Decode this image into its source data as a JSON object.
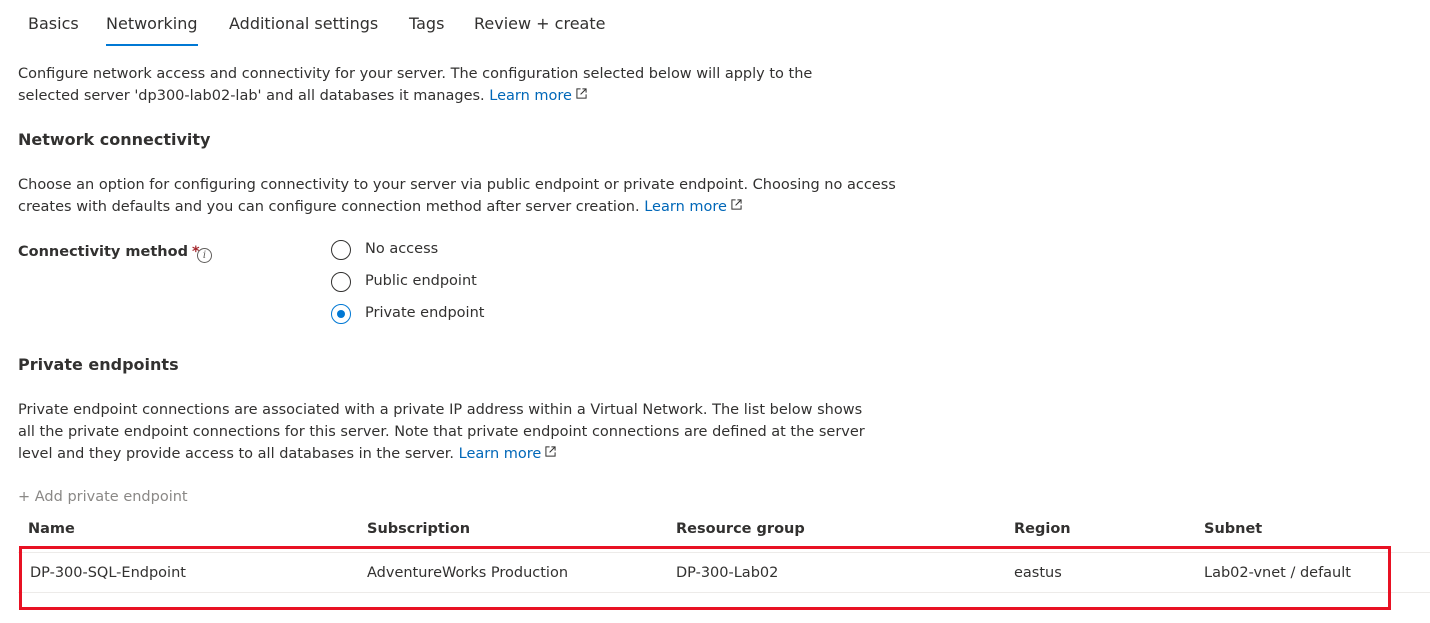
{
  "tabs": [
    {
      "label": "Basics"
    },
    {
      "label": "Networking",
      "active": true
    },
    {
      "label": "Additional settings"
    },
    {
      "label": "Tags"
    },
    {
      "label": "Review + create"
    }
  ],
  "intro": {
    "text": "Configure network access and connectivity for your server. The configuration selected below will apply to the selected server 'dp300-lab02-lab' and all databases it manages.",
    "link": "Learn more"
  },
  "network_connectivity": {
    "heading": "Network connectivity",
    "description": "Choose an option for configuring connectivity to your server via public endpoint or private endpoint. Choosing no access creates with defaults and you can configure connection method after server creation.",
    "link": "Learn more",
    "connectivity_label": "Connectivity method",
    "required_marker": "*",
    "info_icon": "info-icon",
    "options": [
      {
        "label": "No access",
        "checked": false
      },
      {
        "label": "Public endpoint",
        "checked": false
      },
      {
        "label": "Private endpoint",
        "checked": true
      }
    ]
  },
  "private_endpoints": {
    "heading": "Private endpoints",
    "description": "Private endpoint connections are associated with a private IP address within a Virtual Network. The list below shows all the private endpoint connections for this server. Note that private endpoint connections are defined at the server level and they provide access to all databases in the server.",
    "link": "Learn more",
    "add_label": "+ Add private endpoint",
    "columns": [
      "Name",
      "Subscription",
      "Resource group",
      "Region",
      "Subnet"
    ],
    "rows": [
      [
        "DP-300-SQL-Endpoint",
        "AdventureWorks Production",
        "DP-300-Lab02",
        "eastus",
        "Lab02-vnet / default"
      ]
    ]
  },
  "colors": {
    "accent": "#0078d4",
    "link": "#0067b8",
    "highlight": "#e81123"
  }
}
